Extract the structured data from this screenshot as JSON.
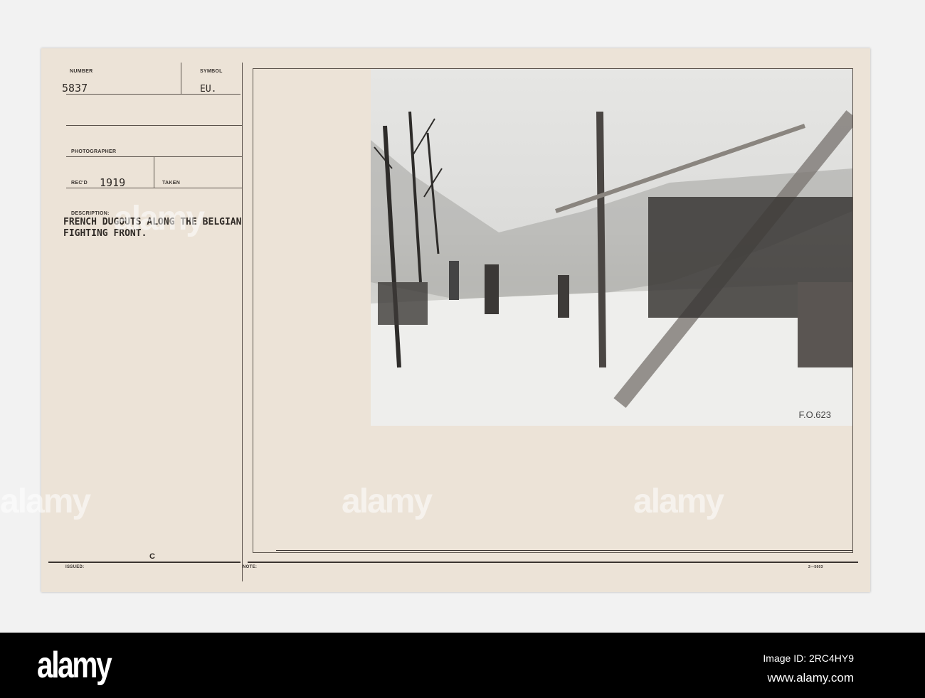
{
  "record": {
    "number_label": "NUMBER",
    "number": "5837",
    "symbol_label": "SYMBOL",
    "symbol": "EU.",
    "photographer_label": "PHOTOGRAPHER",
    "recd_label": "REC'D",
    "recd": "1919",
    "taken_label": "TAKEN",
    "description_label": "DESCRIPTION:",
    "description_line1": "FRENCH DUGOUTS ALONG THE BELGIAN",
    "description_line2": "FIGHTING FRONT.",
    "issued_label": "ISSUED:",
    "issued_mark": "C",
    "note_label": "NOTE:",
    "form_number": "2—5603",
    "photo_code": "F.O.623"
  },
  "watermark": "alamy",
  "footer": {
    "logo": "alamy",
    "image_id": "Image ID: 2RC4HY9",
    "url": "www.alamy.com"
  }
}
